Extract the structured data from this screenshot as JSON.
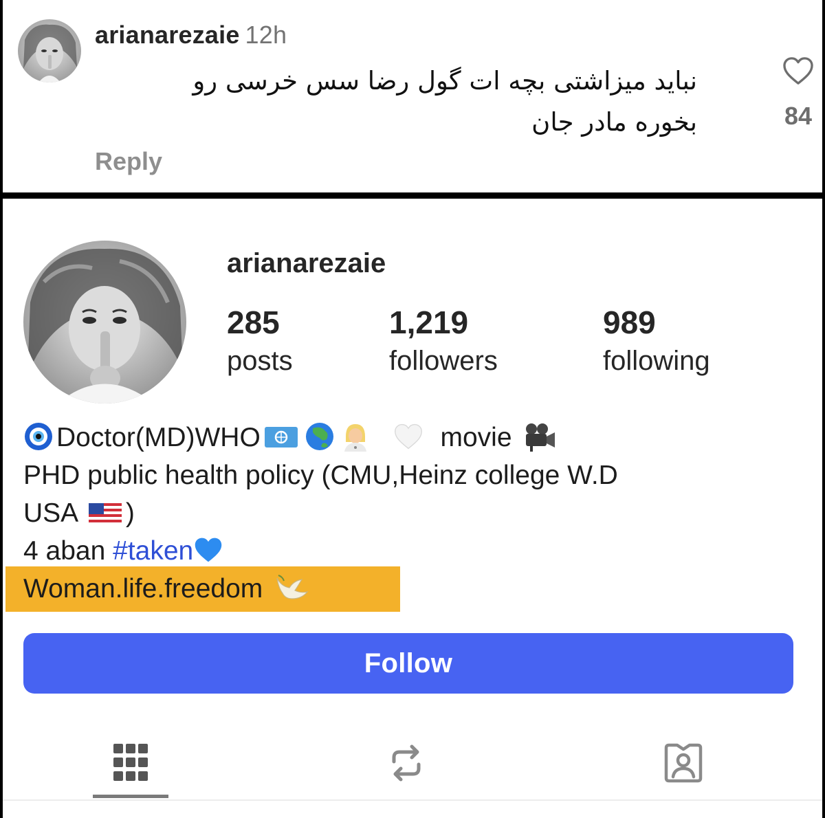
{
  "comment": {
    "username": "arianarezaie",
    "time": "12h",
    "text_line1": "نباید میزاشتی بچه ات گول رضا سس خرسی رو",
    "text_line2": "بخوره مادر جان",
    "reply_label": "Reply",
    "like_count": "84",
    "heart_icon": "heart-outline-icon"
  },
  "profile": {
    "username": "arianarezaie",
    "stats": [
      {
        "value": "285",
        "label": "posts"
      },
      {
        "value": "1,219",
        "label": "followers"
      },
      {
        "value": "989",
        "label": "following"
      }
    ],
    "bio": {
      "line1_text": "Doctor(MD)WHO",
      "line1_after": "movie",
      "line2": "PHD public health policy (CMU,Heinz college W.D",
      "line3_text": "USA",
      "line3_after": ")",
      "line4_prefix": "4 aban",
      "line4_hashtag": "#taken",
      "line5": "Woman.life.freedom"
    },
    "emoji_icons": [
      "evil-eye-icon",
      "un-flag-icon",
      "globe-asia-icon",
      "woman-doctor-icon",
      "white-heart-icon",
      "movie-camera-icon",
      "us-flag-icon",
      "blue-heart-icon",
      "dove-icon"
    ],
    "follow_label": "Follow",
    "tabs": [
      "grid-icon",
      "reels-repost-icon",
      "tagged-icon"
    ]
  },
  "colors": {
    "follow_button": "#4763f2",
    "hashtag": "#2e4fd6",
    "highlight": "#f3b12a"
  }
}
